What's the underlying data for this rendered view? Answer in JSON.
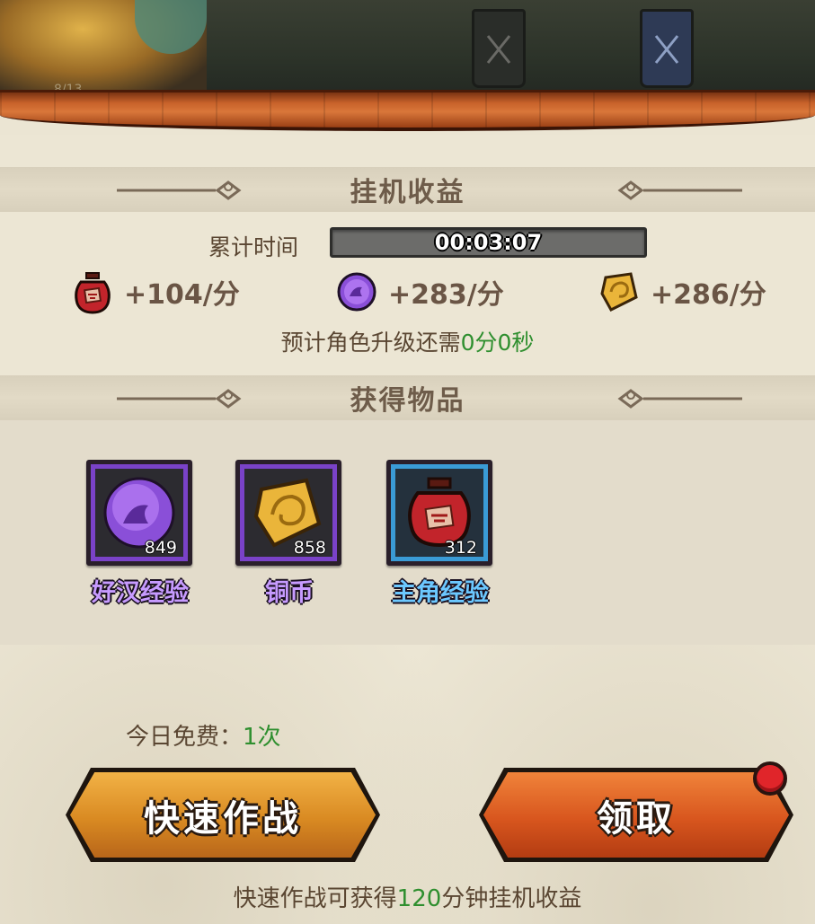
{
  "scene": {
    "hero_caption": "8/13"
  },
  "idle": {
    "title": "挂机收益",
    "timer_label": "累计时间",
    "timer_value": "00:03:07",
    "timer_progress": 0.0,
    "rates": [
      {
        "icon": "red-wine-jar-icon",
        "text": "+104/分"
      },
      {
        "icon": "purple-orb-icon",
        "text": "+283/分"
      },
      {
        "icon": "gold-coin-icon",
        "text": "+286/分"
      }
    ],
    "levelup_prefix": "预计角色升级还需",
    "levelup_value": "0分0秒"
  },
  "items": {
    "title": "获得物品",
    "list": [
      {
        "name": "好汉经验",
        "count": "849",
        "icon": "purple-orb-icon",
        "rarity_color": "#7a42c8",
        "name_color": "#c79bff"
      },
      {
        "name": "铜币",
        "count": "858",
        "icon": "gold-coin-icon",
        "rarity_color": "#7a42c8",
        "name_color": "#c79bff"
      },
      {
        "name": "主角经验",
        "count": "312",
        "icon": "red-wine-jar-icon",
        "rarity_color": "#3a9bd6",
        "name_color": "#6cc8ff"
      }
    ]
  },
  "free": {
    "label": "今日免费：",
    "value": "1次"
  },
  "buttons": {
    "quick_battle": "快速作战",
    "claim": "领取"
  },
  "footer": {
    "prefix": "快速作战可获得",
    "value": "120",
    "suffix": "分钟挂机收益"
  },
  "colors": {
    "accent_green": "#2f8f2f",
    "quick_button": "#d98a22",
    "claim_button": "#d8561e",
    "notification_dot": "#e0252a"
  }
}
